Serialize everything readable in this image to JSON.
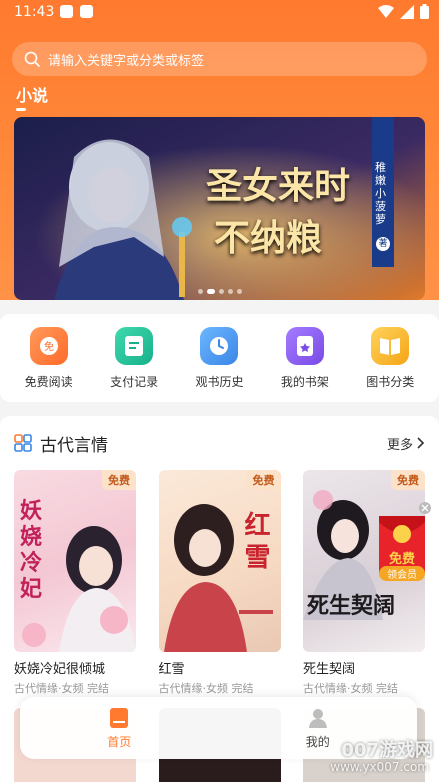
{
  "status_bar": {
    "time": "11:43"
  },
  "search": {
    "placeholder": "请输入关键字或分类或标签"
  },
  "section": {
    "title": "小说"
  },
  "banner": {
    "headline_line1": "圣女来时",
    "headline_line2": "不纳粮",
    "author_tag": "稚嫩小菠萝",
    "author_suffix": "著",
    "slides": 5,
    "active_slide": 2
  },
  "quick_actions": [
    {
      "label": "免费阅读",
      "icon": "free-read-icon",
      "color": "#ff7a3c",
      "glyph": "免"
    },
    {
      "label": "支付记录",
      "icon": "payment-record-icon",
      "color": "#22c39a",
      "glyph": ""
    },
    {
      "label": "观书历史",
      "icon": "history-clock-icon",
      "color": "#4a9bf0",
      "glyph": ""
    },
    {
      "label": "我的书架",
      "icon": "bookshelf-icon",
      "color": "#8a5cf0",
      "glyph": ""
    },
    {
      "label": "图书分类",
      "icon": "category-book-icon",
      "color": "#f7b424",
      "glyph": ""
    }
  ],
  "category": {
    "title": "古代言情",
    "more": "更多",
    "books": [
      {
        "title": "妖娆冷妃很倾城",
        "meta": "古代情缘·女频 完结",
        "badge": "免费",
        "cover_text": "妖娆冷妃"
      },
      {
        "title": "红雪",
        "meta": "古代情缘·女频 完结",
        "badge": "免费",
        "cover_text": "红雪"
      },
      {
        "title": "死生契阔",
        "meta": "古代情缘·女频 完结",
        "badge": "免费",
        "cover_text": "死生契阔"
      }
    ]
  },
  "red_packet": {
    "line1": "免费",
    "line2": "领会员"
  },
  "tabbar": {
    "home": "首页",
    "mine": "我的"
  },
  "watermark": {
    "brand": "007游戏网",
    "url": "www.yx007.com"
  },
  "colors": {
    "accent": "#ff7a2e"
  }
}
